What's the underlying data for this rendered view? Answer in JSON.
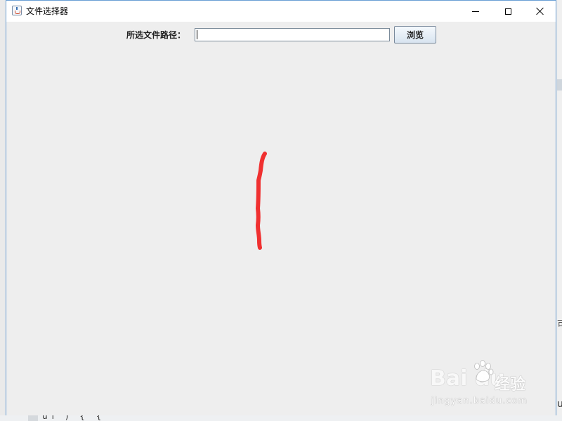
{
  "window": {
    "title": "文件选择器",
    "controls": {
      "minimize_icon": "minimize-icon",
      "maximize_icon": "maximize-icon",
      "close_icon": "close-icon"
    }
  },
  "form": {
    "path_label": "所选文件路径：",
    "path_value": "",
    "browse_label": "浏览"
  },
  "watermark": {
    "logo": "Bai  du",
    "cn": "经验",
    "url": "jingyan.baidu.com"
  },
  "background": {
    "right_glyph": "可",
    "right_glyph2": "u",
    "bottom_text": "ui      ) { {"
  },
  "colors": {
    "annotation": "#f03030",
    "window_border": "#6a9fd4",
    "content_bg": "#eeeeee"
  }
}
